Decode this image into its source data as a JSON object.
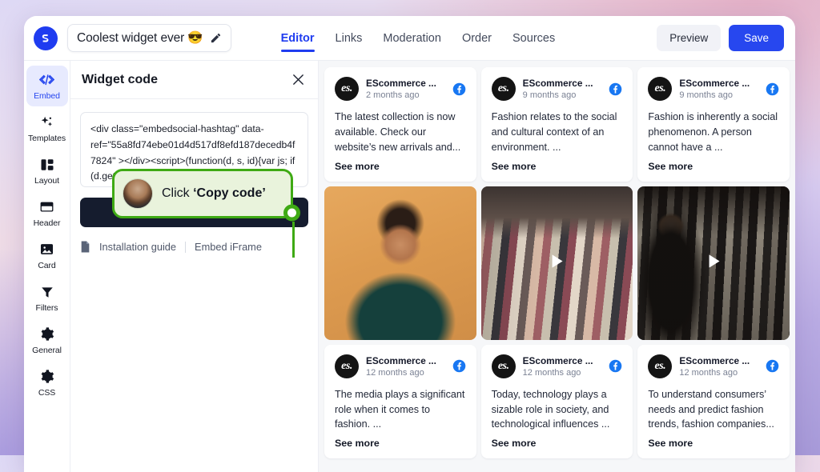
{
  "topbar": {
    "logo_name": "embedsocial-logo",
    "widget_title": "Coolest widget ever 😎",
    "edit_icon": "pencil-icon",
    "nav": [
      {
        "label": "Editor",
        "active": true
      },
      {
        "label": "Links",
        "active": false
      },
      {
        "label": "Moderation",
        "active": false
      },
      {
        "label": "Order",
        "active": false
      },
      {
        "label": "Sources",
        "active": false
      }
    ],
    "preview_label": "Preview",
    "save_label": "Save",
    "accent_color": "#2747ef"
  },
  "sidebar": {
    "items": [
      {
        "label": "Embed",
        "icon": "code-icon",
        "active": true
      },
      {
        "label": "Templates",
        "icon": "sparkles-icon",
        "active": false
      },
      {
        "label": "Layout",
        "icon": "layout-icon",
        "active": false
      },
      {
        "label": "Header",
        "icon": "header-icon",
        "active": false
      },
      {
        "label": "Card",
        "icon": "image-icon",
        "active": false
      },
      {
        "label": "Filters",
        "icon": "funnel-icon",
        "active": false
      },
      {
        "label": "General",
        "icon": "gear-icon",
        "active": false
      },
      {
        "label": "CSS",
        "icon": "gear-icon",
        "active": false
      }
    ]
  },
  "code_panel": {
    "title": "Widget code",
    "close_icon": "close-icon",
    "code": "<div class=\"embedsocial-hashtag\" data-ref=\"55a8fd74ebe01d4d517df8efd187decedb4f7824\" ></div><script>(function(d, s, id){var js; if (d.getElementById(id)) {return;} js =",
    "copy_label": "Copy code",
    "installation_guide_label": "Installation guide",
    "embed_iframe_label": "Embed iFrame",
    "callout": {
      "text_prefix": "Click ",
      "text_emphasis": "‘Copy code’",
      "accent_color": "#3faa14"
    }
  },
  "feed": {
    "row1": [
      {
        "author": "EScommerce ...",
        "time": "2 months ago",
        "network": "facebook-icon",
        "text": "The latest collection is now available. Check our website’s new arrivals and...",
        "see_more": "See more",
        "avatar_initials": "es."
      },
      {
        "author": "EScommerce ...",
        "time": "9 months ago",
        "network": "facebook-icon",
        "text": "Fashion relates to the social and cultural context of an environment. ...",
        "see_more": "See more",
        "avatar_initials": "es."
      },
      {
        "author": "EScommerce ...",
        "time": "9 months ago",
        "network": "facebook-icon",
        "text": "Fashion is inherently a social phenomenon. A person cannot have a ...",
        "see_more": "See more",
        "avatar_initials": "es."
      }
    ],
    "media": [
      {
        "alt": "smiling-man-in-green-sweater-photo",
        "has_play": false
      },
      {
        "alt": "clothing-rack-with-colorful-hangers-video",
        "has_play": true
      },
      {
        "alt": "woman-in-leather-jacket-by-clothing-rack-video",
        "has_play": true
      }
    ],
    "row2": [
      {
        "author": "EScommerce ...",
        "time": "12 months ago",
        "network": "facebook-icon",
        "text": "The media plays a significant role when it comes to fashion. ...",
        "see_more": "See more",
        "avatar_initials": "es."
      },
      {
        "author": "EScommerce ...",
        "time": "12 months ago",
        "network": "facebook-icon",
        "text": "Today, technology plays a sizable role in society, and technological influences ...",
        "see_more": "See more",
        "avatar_initials": "es."
      },
      {
        "author": "EScommerce ...",
        "time": "12 months ago",
        "network": "facebook-icon",
        "text": "To understand consumers’ needs and predict fashion trends, fashion companies...",
        "see_more": "See more",
        "avatar_initials": "es."
      }
    ]
  }
}
